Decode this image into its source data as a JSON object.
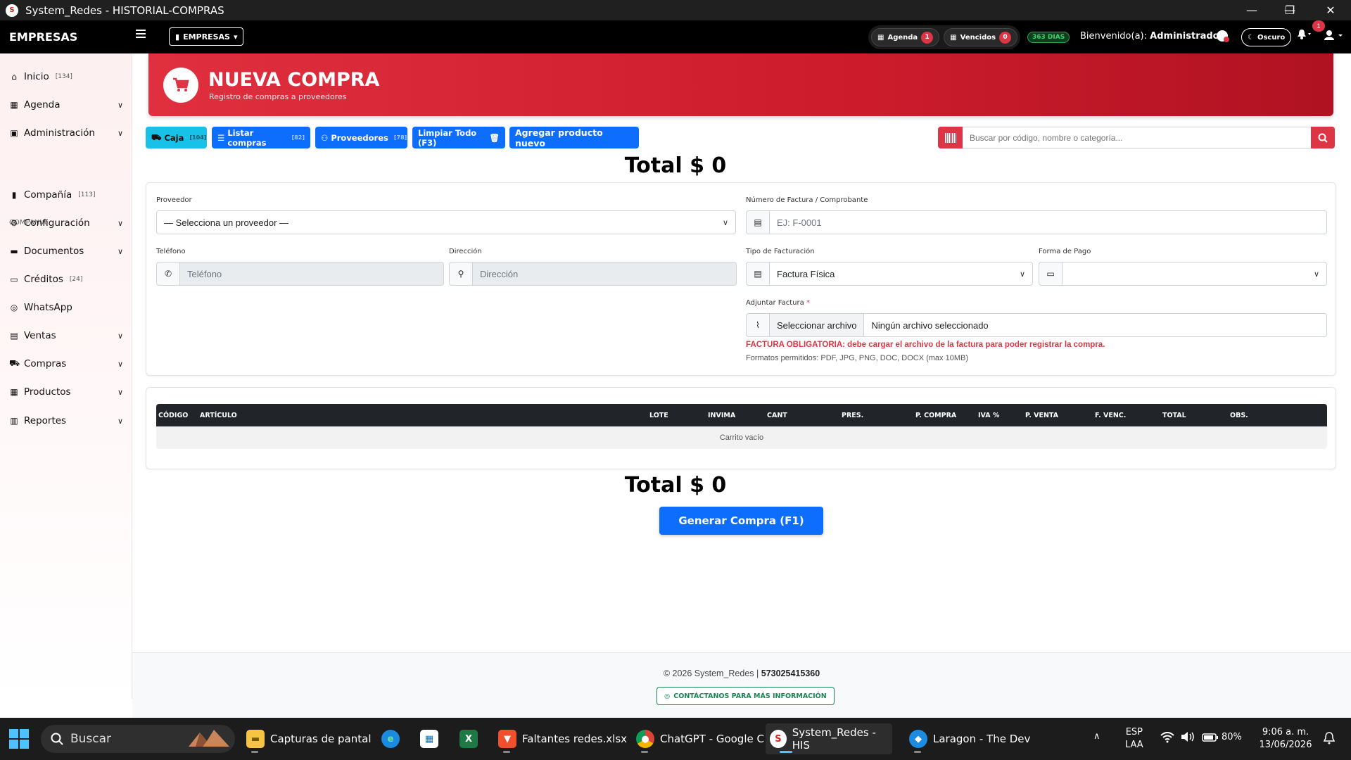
{
  "window": {
    "logo_text": "S",
    "title": "System_Redes - HISTORIAL-COMPRAS",
    "minimize": "—",
    "restore": "❐",
    "close": "✕"
  },
  "navbar": {
    "brand": "EMPRESAS",
    "empresas_button": "EMPRESAS",
    "agenda_label": "Agenda",
    "agenda_count": "1",
    "vencidos_label": "Vencidos",
    "vencidos_count": "0",
    "days_badge": "363 DIAS",
    "welcome_prefix": "Bienvenido(a):",
    "welcome_user": "Administrador",
    "theme_label": "Oscuro",
    "notifications_count": "1"
  },
  "sidebar": {
    "section_label": "COMPANIA",
    "items": [
      {
        "label": "Inicio",
        "count": "[134]",
        "icon": "home-icon"
      },
      {
        "label": "Agenda",
        "count": "",
        "icon": "calendar-icon"
      },
      {
        "label": "Administración",
        "count": "",
        "icon": "id-card-icon"
      },
      {
        "label": "Compañía",
        "count": "[113]",
        "icon": "building-icon"
      },
      {
        "label": "Configuración",
        "count": "",
        "icon": "gears-icon"
      },
      {
        "label": "Documentos",
        "count": "",
        "icon": "folder-icon"
      },
      {
        "label": "Créditos",
        "count": "[24]",
        "icon": "money-icon"
      },
      {
        "label": "WhatsApp",
        "count": "",
        "icon": "whatsapp-icon"
      },
      {
        "label": "Ventas",
        "count": "",
        "icon": "cash-register-icon"
      },
      {
        "label": "Compras",
        "count": "",
        "icon": "cart-icon"
      },
      {
        "label": "Productos",
        "count": "",
        "icon": "boxes-icon"
      },
      {
        "label": "Reportes",
        "count": "",
        "icon": "chart-icon"
      }
    ]
  },
  "header": {
    "title": "NUEVA COMPRA",
    "subtitle": "Registro de compras a proveedores"
  },
  "toolbar": {
    "caja_label": "Caja",
    "caja_shortcut": "[104]",
    "listar_label": "Listar compras",
    "listar_shortcut": "[82]",
    "proveedores_label": "Proveedores",
    "proveedores_shortcut": "[78]",
    "limpiar_label": "Limpiar Todo (F3)",
    "agregar_label": "Agregar producto nuevo",
    "search_placeholder": "Buscar por código, nombre o categoría..."
  },
  "totals": {
    "top": "Total $ 0",
    "bottom": "Total $ 0"
  },
  "form": {
    "proveedor_label": "Proveedor",
    "proveedor_value": "— Selecciona un proveedor —",
    "factura_label": "Número de Factura / Comprobante",
    "factura_placeholder": "EJ: F-0001",
    "telefono_label": "Teléfono",
    "telefono_placeholder": "Teléfono",
    "direccion_label": "Dirección",
    "direccion_placeholder": "Dirección",
    "tipo_label": "Tipo de Facturación",
    "tipo_value": "Factura Física",
    "pago_label": "Forma de Pago",
    "pago_value": "",
    "adjuntar_label": "Adjuntar Factura",
    "adjuntar_required": "*",
    "file_button": "Seleccionar archivo",
    "file_name": "Ningún archivo seleccionado",
    "warning": "FACTURA OBLIGATORIA: debe cargar el archivo de la factura para poder registrar la compra.",
    "formats": "Formatos permitidos: PDF, JPG, PNG, DOC, DOCX (max 10MB)"
  },
  "table": {
    "columns": [
      "CÓDIGO",
      "ARTÍCULO",
      "LOTE",
      "INVIMA",
      "CANT",
      "PRES.",
      "P. COMPRA",
      "IVA %",
      "P. VENTA",
      "F. VENC.",
      "TOTAL",
      "OBS."
    ],
    "empty_text": "Carrito vacío"
  },
  "actions": {
    "generate_label": "Generar Compra (F1)"
  },
  "footer": {
    "copyright": "© 2026 System_Redes |",
    "phone": "573025415360",
    "contact_label": "CONTÁCTANOS PARA MÁS INFORMACIÓN"
  },
  "taskbar": {
    "search_label": "Buscar",
    "apps": [
      {
        "label": "Capturas de pantal",
        "icon": "folder-icon"
      },
      {
        "label": "",
        "icon": "edge-icon"
      },
      {
        "label": "",
        "icon": "store-icon"
      },
      {
        "label": "",
        "icon": "excel-icon"
      },
      {
        "label": "Faltantes redes.xlsx",
        "icon": "brave-icon"
      },
      {
        "label": "ChatGPT - Google C",
        "icon": "chrome-icon"
      },
      {
        "label": "System_Redes - HIS",
        "icon": "system-redes-icon"
      },
      {
        "label": "Laragon - The Dev",
        "icon": "laragon-icon"
      }
    ],
    "language_top": "ESP",
    "language_bottom": "LAA",
    "battery": "80%",
    "time": "9:06 a. m.",
    "date": "13/06/2026"
  },
  "colors": {
    "primary": "#0d6efd",
    "danger": "#dc3545",
    "info": "#17c1e8",
    "success": "#198754",
    "dark": "#212529"
  }
}
